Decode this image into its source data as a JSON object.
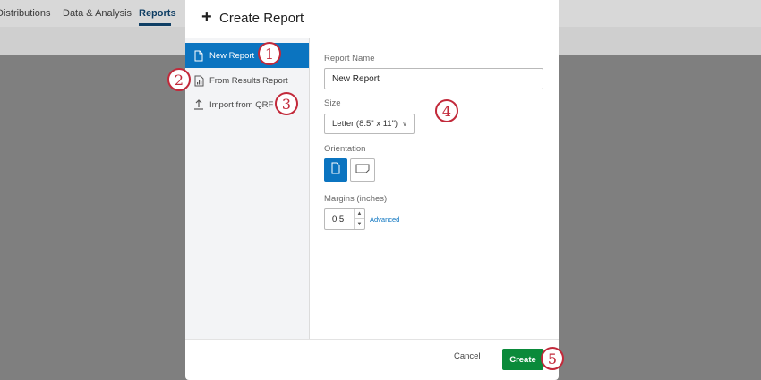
{
  "background": {
    "tabs": [
      {
        "label": "Distributions",
        "active": false
      },
      {
        "label": "Data & Analysis",
        "active": false
      },
      {
        "label": "Reports",
        "active": true
      }
    ]
  },
  "modal": {
    "title": "Create Report",
    "header_icon": "plus-icon",
    "sidebar": {
      "items": [
        {
          "label": "New Report",
          "icon": "document-icon",
          "active": true
        },
        {
          "label": "From Results Report",
          "icon": "bar-chart-document-icon",
          "active": false
        },
        {
          "label": "Import from QRF",
          "icon": "upload-icon",
          "active": false
        }
      ]
    },
    "form": {
      "report_name_label": "Report Name",
      "report_name_value": "New Report",
      "size_label": "Size",
      "size_value": "Letter (8.5\" x 11\")",
      "orientation_label": "Orientation",
      "orientation_selected": "portrait",
      "margins_label": "Margins (inches)",
      "margins_value": "0.5",
      "advanced_label": "Advanced"
    },
    "footer": {
      "cancel_label": "Cancel",
      "create_label": "Create"
    }
  },
  "callouts": [
    "1",
    "2",
    "3",
    "4",
    "5"
  ],
  "colors": {
    "accent": "#0b74c0",
    "create_button": "#0a8a3a",
    "callout": "#c2293a"
  }
}
